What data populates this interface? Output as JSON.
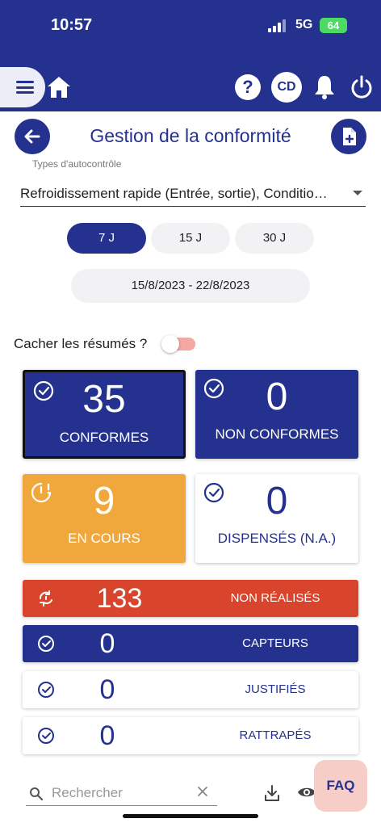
{
  "status": {
    "time": "10:57",
    "network": "5G",
    "battery": "64"
  },
  "appbar": {
    "avatar_initials": "CD",
    "help_glyph": "?"
  },
  "header": {
    "title": "Gestion de la conformité"
  },
  "filter": {
    "label": "Types d'autocontrôle",
    "value": "Refroidissement rapide (Entrée, sortie), Conditio…"
  },
  "ranges": [
    {
      "label": "7 J",
      "active": true
    },
    {
      "label": "15 J",
      "active": false
    },
    {
      "label": "30 J",
      "active": false
    }
  ],
  "date_range": "15/8/2023 - 22/8/2023",
  "toggle": {
    "label": "Cacher les résumés ?"
  },
  "summary": {
    "conformes": {
      "count": "35",
      "label": "CONFORMES"
    },
    "non_conformes": {
      "count": "0",
      "label": "NON CONFORMES"
    },
    "en_cours": {
      "count": "9",
      "label": "EN COURS"
    },
    "dispenses": {
      "count": "0",
      "label": "DISPENSÉS (N.A.)"
    },
    "non_realises": {
      "count": "133",
      "label": "NON RÉALISÉS"
    },
    "capteurs": {
      "count": "0",
      "label": "CAPTEURS"
    },
    "justifies": {
      "count": "0",
      "label": "JUSTIFIÉS"
    },
    "rattrapes": {
      "count": "0",
      "label": "RATTRAPÉS"
    }
  },
  "search": {
    "placeholder": "Rechercher"
  },
  "faq": {
    "label": "FAQ"
  },
  "colors": {
    "brand": "#24318f",
    "warning": "#f0a73c",
    "danger": "#d9442c"
  }
}
